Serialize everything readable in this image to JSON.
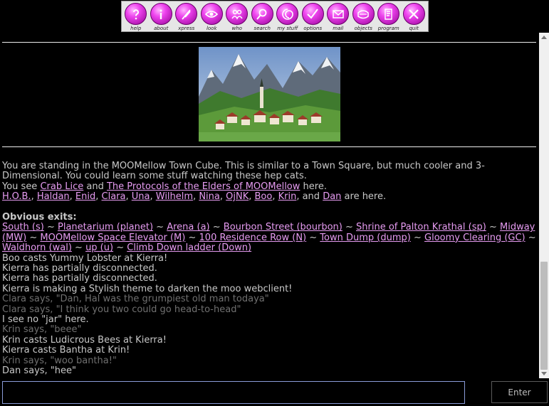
{
  "toolbar": {
    "buttons": [
      {
        "label": "help",
        "icon": "question-icon"
      },
      {
        "label": "about",
        "icon": "info-icon"
      },
      {
        "label": "xpress",
        "icon": "quill-icon"
      },
      {
        "label": "look",
        "icon": "eye-icon"
      },
      {
        "label": "who",
        "icon": "people-icon"
      },
      {
        "label": "search",
        "icon": "magnifier-icon"
      },
      {
        "label": "my stuff",
        "icon": "swirl-icon"
      },
      {
        "label": "options",
        "icon": "check-icon"
      },
      {
        "label": "mail",
        "icon": "envelope-icon"
      },
      {
        "label": "objects",
        "icon": "pad-icon"
      },
      {
        "label": "program",
        "icon": "script-icon"
      },
      {
        "label": "quit",
        "icon": "x-icon"
      }
    ],
    "color_accent": "#ee44ee"
  },
  "room": {
    "scene_image": "alpine-village-image",
    "description_1": "You are standing in the MOOMellow Town Cube. This is similar to a Town Square, but much cooler and 3-Dimensional. You could learn some stuff watching these hep cats.",
    "see_prefix": "You see ",
    "items": [
      "Crab Lice",
      "The Protocols of the Elders of MOOMellow"
    ],
    "see_and": " and ",
    "see_suffix": " here.",
    "players": [
      "H.O.B.",
      "Haldan",
      "Enid",
      "Clara",
      "Una",
      "Wilhelm",
      "Nina",
      "OjNK",
      "Boo",
      "Krin",
      "Dan"
    ],
    "players_suffix": " are here.",
    "exits_heading": "Obvious exits:",
    "exits": [
      "South (s)",
      "Planetarium (planet)",
      "Arena (a)",
      "Bourbon Street (bourbon)",
      "Shrine of Palton Krathal (sp)",
      "Midway (MW)",
      "MOOMellow Space Elevator (M)",
      "100 Residence Row (N)",
      "Town Dump (dump)",
      "Gloomy Clearing (GC)",
      "Waldhorn (wal)",
      "up (u)",
      "Climb Down ladder (Down)"
    ],
    "exit_separator": " ~ "
  },
  "messages": [
    {
      "text": "Boo casts Yummy Lobster at Kierra!",
      "dim": false
    },
    {
      "text": "Kierra has partially disconnected.",
      "dim": false
    },
    {
      "text": "Kierra has partially disconnected.",
      "dim": false
    },
    {
      "text": "Kierra is making a Stylish theme to darken the moo webclient!",
      "dim": false
    },
    {
      "text": "Clara says, \"Dan, Hal was the grumpiest old man todaya\"",
      "dim": true
    },
    {
      "text": "Clara says, \"I think you two could go head-to-head\"",
      "dim": true
    },
    {
      "text": "I see no \"jar\" here.",
      "dim": false
    },
    {
      "text": "Krin says, \"beee\"",
      "dim": true
    },
    {
      "text": "Krin casts Ludicrous Bees at Kierra!",
      "dim": false
    },
    {
      "text": "Kierra casts Bantha at Krin!",
      "dim": false
    },
    {
      "text": "Krin says, \"woo bantha!\"",
      "dim": true
    },
    {
      "text": "Dan says, \"hee\"",
      "dim": false
    }
  ],
  "input": {
    "value": "",
    "placeholder": ""
  },
  "enter_label": "Enter",
  "colors": {
    "link": "#e79cf2",
    "text": "#c8c8c8",
    "dim_text": "#707070",
    "background": "#000000"
  }
}
